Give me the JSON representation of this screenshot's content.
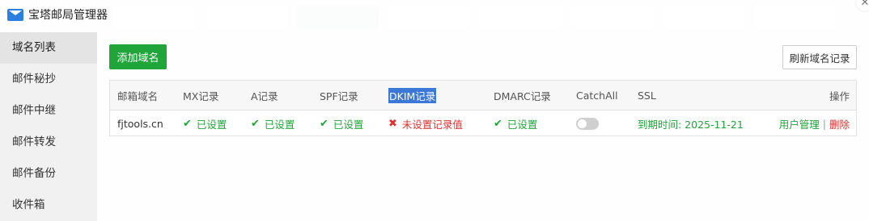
{
  "window": {
    "title": "宝塔邮局管理器",
    "close_label": "✕"
  },
  "sidebar": {
    "items": [
      {
        "label": "域名列表",
        "active": true
      },
      {
        "label": "邮件秘抄",
        "active": false
      },
      {
        "label": "邮件中继",
        "active": false
      },
      {
        "label": "邮件转发",
        "active": false
      },
      {
        "label": "邮件备份",
        "active": false
      },
      {
        "label": "收件箱",
        "active": false
      }
    ]
  },
  "toolbar": {
    "add_domain_label": "添加域名",
    "refresh_label": "刷新域名记录"
  },
  "table": {
    "headers": {
      "domain": "邮箱域名",
      "mx": "MX记录",
      "a": "A记录",
      "spf": "SPF记录",
      "dkim": "DKIM记录",
      "dmarc": "DMARC记录",
      "catchall": "CatchAll",
      "ssl": "SSL",
      "ops": "操作"
    },
    "rows": [
      {
        "domain": "fjtools.cn",
        "mx": "已设置",
        "a": "已设置",
        "spf": "已设置",
        "dkim": "未设置记录值",
        "dmarc": "已设置",
        "catchall_enabled": false,
        "ssl": "到期时间: 2025-11-21",
        "user_manage": "用户管理",
        "separator": "|",
        "delete": "删除"
      }
    ]
  },
  "colors": {
    "accent_green": "#20a53a",
    "error_red": "#e03131",
    "selection_blue": "#3b78d8"
  }
}
